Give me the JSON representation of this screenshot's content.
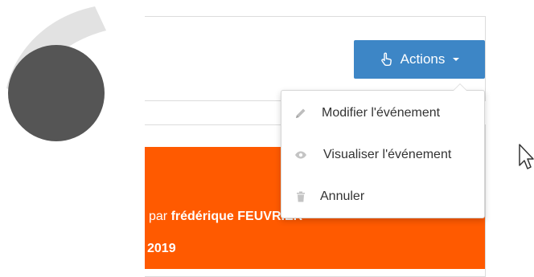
{
  "colors": {
    "primary_button": "#3d86c6",
    "banner": "#ff5a00",
    "step_mark": "#555555",
    "step_mark_light": "#e2e2e2"
  },
  "actions_button": {
    "label": "Actions",
    "icon": "hand-pointer-icon",
    "caret_icon": "caret-down-icon"
  },
  "dropdown": {
    "items": [
      {
        "label": "Modifier l'événement",
        "icon": "pencil-icon"
      },
      {
        "label": "Visualiser l'événement",
        "icon": "eye-icon"
      },
      {
        "label": "Annuler",
        "icon": "trash-icon"
      }
    ]
  },
  "banner": {
    "by_text": "par",
    "author": "frédérique FEUVRIER",
    "year_fragment": "2019"
  }
}
